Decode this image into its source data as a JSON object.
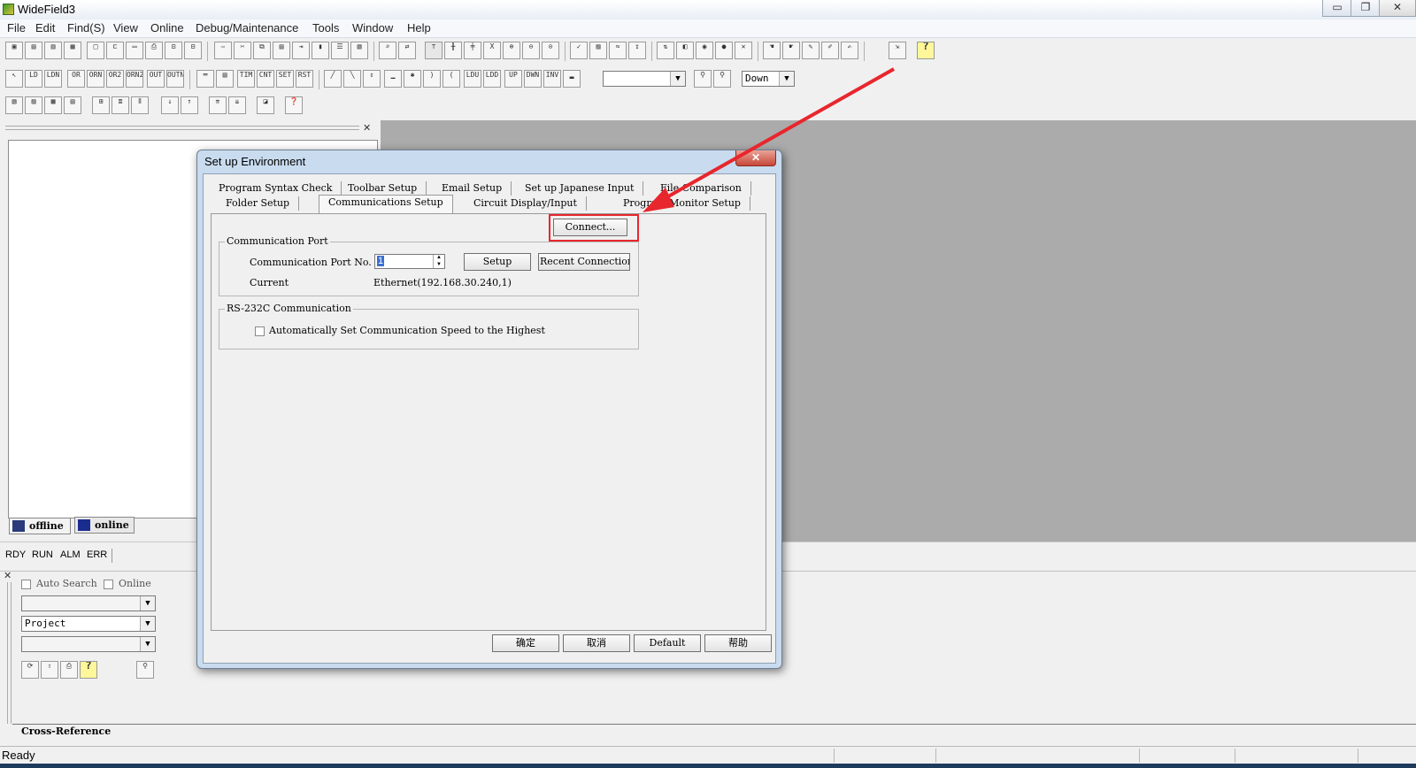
{
  "app": {
    "title": "WideField3"
  },
  "window_controls": {
    "minimize": "▭",
    "restore": "❐",
    "close": "✕"
  },
  "menu": [
    "File",
    "Edit",
    "Find(S)",
    "View",
    "Online",
    "Debug/Maintenance",
    "Tools",
    "Window",
    "Help"
  ],
  "toolbar2": {
    "ladder_buttons": [
      "LD",
      "LDN",
      "OR",
      "ORN",
      "OR2",
      "ORN2",
      "OUT",
      "OUTN"
    ],
    "ladder_buttons2": [
      "TIM",
      "CNT",
      "SET",
      "RST"
    ],
    "ladder_buttons3": [
      "LDU",
      "LDD",
      "UP",
      "DWN",
      "INV"
    ],
    "search_combo": "",
    "direction_combo": "Down"
  },
  "left_panel": {
    "tabs": [
      {
        "label": "offline"
      },
      {
        "label": "online"
      }
    ],
    "status_indicators": [
      "RDY",
      "RUN",
      "ALM",
      "ERR"
    ]
  },
  "bottom_panel": {
    "auto_search_label": "Auto Search",
    "online_label": "Online",
    "combo1": "",
    "project_combo": "Project",
    "combo3": "",
    "cross_reference_tab": "Cross-Reference"
  },
  "statusbar": {
    "text": "Ready"
  },
  "dialog": {
    "title": "Set up Environment",
    "close_label": "✕",
    "tabs_row1": [
      "Program Syntax Check",
      "Toolbar Setup",
      "Email Setup",
      "Set up Japanese Input",
      "File Comparison"
    ],
    "tabs_row2": [
      "Folder Setup",
      "Communications Setup",
      "Circuit Display/Input",
      "Program Monitor Setup"
    ],
    "active_tab": "Communications Setup",
    "connect_button": "Connect...",
    "comm_port_group": "Communication Port",
    "comm_port_label": "Communication Port No.",
    "comm_port_value": "1",
    "setup_button": "Setup",
    "recent_connection_button": "Recent Connection:",
    "current_label": "Current",
    "current_value": "Ethernet(192.168.30.240,1)",
    "rs232_group": "RS-232C Communication",
    "auto_speed_label": "Automatically Set Communication Speed to the Highest",
    "auto_speed_checked": false,
    "ok_button": "确定",
    "cancel_button": "取消",
    "default_button": "Default",
    "help_button": "帮助"
  },
  "colors": {
    "highlight": "#e8262d",
    "mdi_background": "#ababab",
    "dialog_frame": "#c9dbee"
  }
}
